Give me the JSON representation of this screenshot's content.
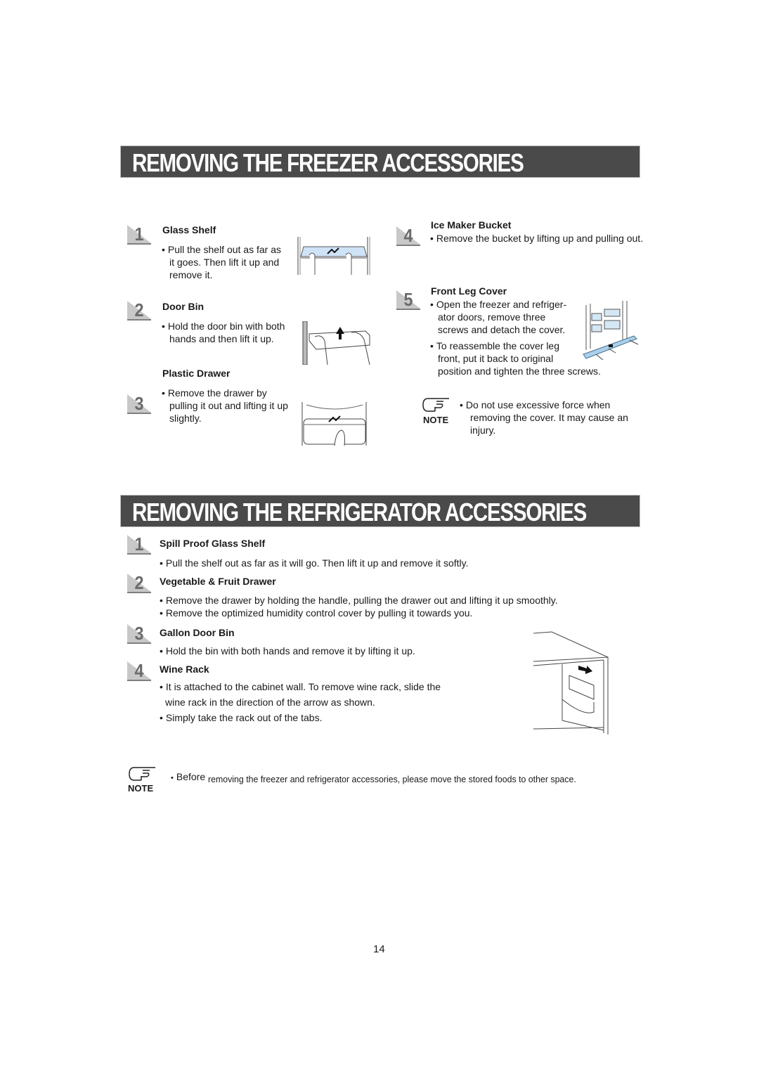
{
  "freezer": {
    "heading": "REMOVING THE FREEZER ACCESSORIES",
    "steps": [
      {
        "num": "1",
        "title": "Glass Shelf",
        "lines": [
          "Pull the shelf out as far as",
          "it goes. Then lift it up and",
          "remove it."
        ],
        "illustration": "glass-shelf-illustration"
      },
      {
        "num": "2",
        "title": "Door Bin",
        "lines": [
          "Hold the door bin with both",
          "hands and then lift it up."
        ],
        "illustration": "door-bin-illustration"
      },
      {
        "num": "3",
        "title": "Plastic Drawer",
        "lines": [
          "Remove the drawer by",
          "pulling it out and lifting it up",
          "slightly."
        ],
        "illustration": "plastic-drawer-illustration"
      },
      {
        "num": "4",
        "title": "Ice Maker Bucket",
        "lines": [
          "Remove the bucket by lifting up and pulling out."
        ]
      },
      {
        "num": "5",
        "title": "Front  Leg Cover",
        "bullets": [
          [
            "Open the freezer and refriger-",
            "ator doors, remove three",
            "screws and detach the cover."
          ],
          [
            "To reassemble the cover leg",
            "front, put it back to original",
            "position and tighten the three screws."
          ]
        ],
        "illustration": "front-leg-cover-illustration"
      }
    ],
    "note": {
      "label": "NOTE",
      "icon": "pointing-hand-icon",
      "lines": [
        "Do not use excessive force when",
        "removing the cover. It may cause an",
        "injury."
      ]
    }
  },
  "refrigerator": {
    "heading": "REMOVING THE  REFRIGERATOR ACCESSORIES",
    "steps": [
      {
        "num": "1",
        "title": "Spill Proof Glass Shelf",
        "bullets": [
          "Pull the shelf out as far as it will go. Then lift it up and remove it softly."
        ]
      },
      {
        "num": "2",
        "title": "Vegetable & Fruit Drawer",
        "bullets": [
          "Remove the drawer by holding the handle, pulling the drawer out and lifting it up smoothly.",
          "Remove the optimized humidity control cover by pulling it towards you."
        ]
      },
      {
        "num": "3",
        "title": "Gallon Door Bin",
        "bullets": [
          "Hold the bin with both hands and remove it by lifting it up."
        ]
      },
      {
        "num": "4",
        "title": "Wine Rack",
        "bullets": [
          "It is attached to the cabinet wall. To remove wine rack, slide the",
          "wine rack in the direction of the arrow as shown.",
          "Simply take the rack out of the tabs."
        ],
        "illustration": "wine-rack-illustration"
      }
    ]
  },
  "bottom_note": {
    "label": "NOTE",
    "icon": "pointing-hand-icon",
    "text_lead": "Before",
    "text": "removing the freezer and refrigerator accessories, please move the stored foods to other space."
  },
  "page_number": "14"
}
